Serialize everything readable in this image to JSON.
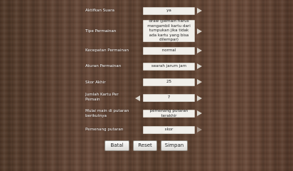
{
  "settings": [
    {
      "label": "Aktifkan Suara",
      "value": "ya"
    },
    {
      "label": "Tipe Permainan",
      "value": "draw (pemain harus mengambil kartu dari tumpukan jika tidak ada kartu yang bisa dilempar)"
    },
    {
      "label": "Kecepatan Permainan",
      "value": "normal"
    },
    {
      "label": "Aturan Permainan",
      "value": "searah jarum jam"
    },
    {
      "label": "Skor Akhir",
      "value": "25"
    },
    {
      "label": "Jumlah Kartu Per Pemain",
      "value": "7"
    },
    {
      "label": "Mulai main di putaran berikutnya",
      "value": "pemenang putaran terakhir"
    },
    {
      "label": "Pemenang putaran",
      "value": "skor"
    }
  ],
  "buttons": {
    "cancel": "Batal",
    "reset": "Reset",
    "save": "Simpan"
  }
}
